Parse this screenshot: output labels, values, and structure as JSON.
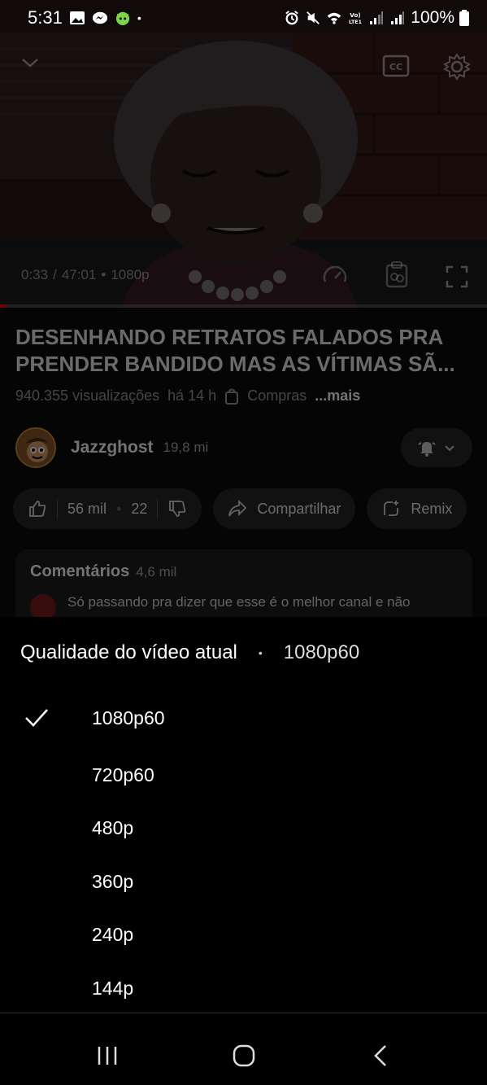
{
  "status_bar": {
    "time": "5:31",
    "battery": "100%",
    "icons": [
      "image-icon",
      "messenger-icon",
      "cat-app-icon",
      "dot-icon",
      "alarm-icon",
      "mute-icon",
      "wifi-icon",
      "volte-icon",
      "signal-icon",
      "signal-icon",
      "battery-icon"
    ]
  },
  "player": {
    "time_current": "0:33",
    "time_total": "47:01",
    "quality_badge": "1080p",
    "progress_fraction": 0.012,
    "icons": [
      "chevron-down-icon",
      "closed-captions-icon",
      "settings-gear-icon",
      "playback-speed-icon",
      "clip-icon",
      "fullscreen-icon"
    ]
  },
  "video_info": {
    "title": "DESENHANDO RETRATOS FALADOS PRA PRENDER BANDIDO MAS AS VÍTIMAS SÃ...",
    "views": "940.355 visualizações",
    "age": "há 14 h",
    "shopping": "Compras",
    "more": "...mais"
  },
  "channel": {
    "name": "Jazzghost",
    "subscribers": "19,8 mi"
  },
  "actions": {
    "likes": "56 mil",
    "comments_count": "22",
    "share": "Compartilhar",
    "remix": "Remix"
  },
  "comments": {
    "header": "Comentários",
    "count": "4,6 mil",
    "top_comment": "Só passando pra dizer que esse é o melhor canal e não"
  },
  "quality_sheet": {
    "header": "Qualidade do vídeo atual",
    "separator": "•",
    "current": "1080p60",
    "options": [
      {
        "label": "1080p60",
        "selected": true
      },
      {
        "label": "720p60",
        "selected": false
      },
      {
        "label": "480p",
        "selected": false
      },
      {
        "label": "360p",
        "selected": false
      },
      {
        "label": "240p",
        "selected": false
      },
      {
        "label": "144p",
        "selected": false
      }
    ]
  },
  "nav_bar": {
    "icons": [
      "recent-apps-icon",
      "home-icon",
      "back-icon"
    ]
  },
  "colors": {
    "accent": "#ff0000",
    "sheet_bg": "#000000",
    "pill_bg": "#262626"
  }
}
